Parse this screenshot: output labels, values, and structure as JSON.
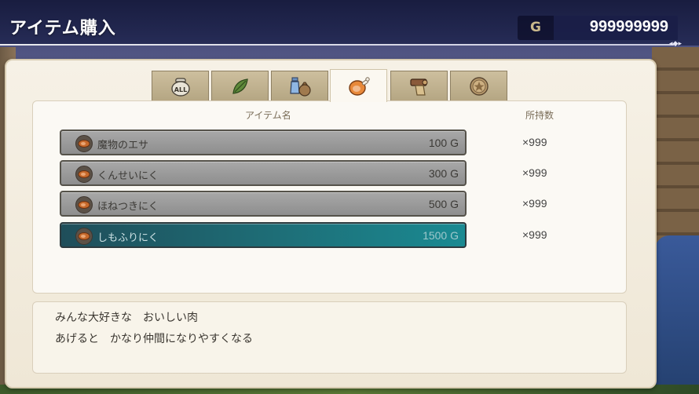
{
  "header": {
    "title": "アイテム購入",
    "gold_label": "G",
    "gold_amount": "999999999"
  },
  "tabs": [
    {
      "id": "all",
      "icon": "all-bag-icon",
      "label": "ALL",
      "active": false
    },
    {
      "id": "herbs",
      "icon": "leaf-icon",
      "active": false
    },
    {
      "id": "potions",
      "icon": "potion-bag-icon",
      "active": false
    },
    {
      "id": "food",
      "icon": "meat-icon",
      "active": true
    },
    {
      "id": "tools",
      "icon": "scroll-icon",
      "active": false
    },
    {
      "id": "valuables",
      "icon": "medal-icon",
      "active": false
    }
  ],
  "list": {
    "column_name": "アイテム名",
    "column_owned": "所持数",
    "items": [
      {
        "name": "魔物のエサ",
        "price": "100 G",
        "owned": "×999",
        "icon": "meat-icon",
        "selected": false
      },
      {
        "name": "くんせいにく",
        "price": "300 G",
        "owned": "×999",
        "icon": "meat-icon",
        "selected": false
      },
      {
        "name": "ほねつきにく",
        "price": "500 G",
        "owned": "×999",
        "icon": "meat-icon",
        "selected": false
      },
      {
        "name": "しもふりにく",
        "price": "1500 G",
        "owned": "×999",
        "icon": "meat-icon",
        "selected": true
      }
    ]
  },
  "description": {
    "line1": "みんな大好きな　おいしい肉",
    "line2": "あげると　かなり仲間になりやすくなる"
  },
  "colors": {
    "selected_row": "#1e6f78",
    "row": "#9b9b9b",
    "panel": "#f6f1e6",
    "header_bg": "#1c2250"
  }
}
